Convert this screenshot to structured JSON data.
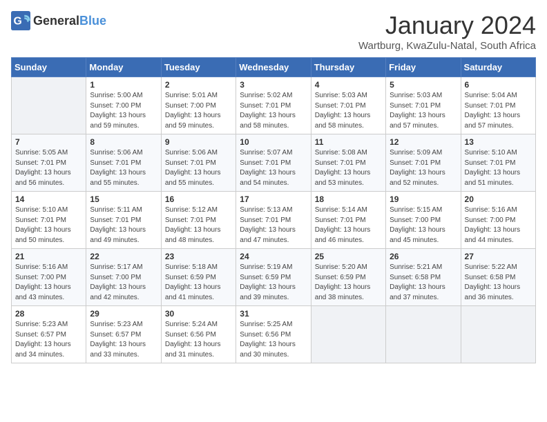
{
  "header": {
    "logo_general": "General",
    "logo_blue": "Blue",
    "month": "January 2024",
    "location": "Wartburg, KwaZulu-Natal, South Africa"
  },
  "weekdays": [
    "Sunday",
    "Monday",
    "Tuesday",
    "Wednesday",
    "Thursday",
    "Friday",
    "Saturday"
  ],
  "weeks": [
    [
      {
        "day": "",
        "sunrise": "",
        "sunset": "",
        "daylight": ""
      },
      {
        "day": "1",
        "sunrise": "Sunrise: 5:00 AM",
        "sunset": "Sunset: 7:00 PM",
        "daylight": "Daylight: 13 hours and 59 minutes."
      },
      {
        "day": "2",
        "sunrise": "Sunrise: 5:01 AM",
        "sunset": "Sunset: 7:00 PM",
        "daylight": "Daylight: 13 hours and 59 minutes."
      },
      {
        "day": "3",
        "sunrise": "Sunrise: 5:02 AM",
        "sunset": "Sunset: 7:01 PM",
        "daylight": "Daylight: 13 hours and 58 minutes."
      },
      {
        "day": "4",
        "sunrise": "Sunrise: 5:03 AM",
        "sunset": "Sunset: 7:01 PM",
        "daylight": "Daylight: 13 hours and 58 minutes."
      },
      {
        "day": "5",
        "sunrise": "Sunrise: 5:03 AM",
        "sunset": "Sunset: 7:01 PM",
        "daylight": "Daylight: 13 hours and 57 minutes."
      },
      {
        "day": "6",
        "sunrise": "Sunrise: 5:04 AM",
        "sunset": "Sunset: 7:01 PM",
        "daylight": "Daylight: 13 hours and 57 minutes."
      }
    ],
    [
      {
        "day": "7",
        "sunrise": "Sunrise: 5:05 AM",
        "sunset": "Sunset: 7:01 PM",
        "daylight": "Daylight: 13 hours and 56 minutes."
      },
      {
        "day": "8",
        "sunrise": "Sunrise: 5:06 AM",
        "sunset": "Sunset: 7:01 PM",
        "daylight": "Daylight: 13 hours and 55 minutes."
      },
      {
        "day": "9",
        "sunrise": "Sunrise: 5:06 AM",
        "sunset": "Sunset: 7:01 PM",
        "daylight": "Daylight: 13 hours and 55 minutes."
      },
      {
        "day": "10",
        "sunrise": "Sunrise: 5:07 AM",
        "sunset": "Sunset: 7:01 PM",
        "daylight": "Daylight: 13 hours and 54 minutes."
      },
      {
        "day": "11",
        "sunrise": "Sunrise: 5:08 AM",
        "sunset": "Sunset: 7:01 PM",
        "daylight": "Daylight: 13 hours and 53 minutes."
      },
      {
        "day": "12",
        "sunrise": "Sunrise: 5:09 AM",
        "sunset": "Sunset: 7:01 PM",
        "daylight": "Daylight: 13 hours and 52 minutes."
      },
      {
        "day": "13",
        "sunrise": "Sunrise: 5:10 AM",
        "sunset": "Sunset: 7:01 PM",
        "daylight": "Daylight: 13 hours and 51 minutes."
      }
    ],
    [
      {
        "day": "14",
        "sunrise": "Sunrise: 5:10 AM",
        "sunset": "Sunset: 7:01 PM",
        "daylight": "Daylight: 13 hours and 50 minutes."
      },
      {
        "day": "15",
        "sunrise": "Sunrise: 5:11 AM",
        "sunset": "Sunset: 7:01 PM",
        "daylight": "Daylight: 13 hours and 49 minutes."
      },
      {
        "day": "16",
        "sunrise": "Sunrise: 5:12 AM",
        "sunset": "Sunset: 7:01 PM",
        "daylight": "Daylight: 13 hours and 48 minutes."
      },
      {
        "day": "17",
        "sunrise": "Sunrise: 5:13 AM",
        "sunset": "Sunset: 7:01 PM",
        "daylight": "Daylight: 13 hours and 47 minutes."
      },
      {
        "day": "18",
        "sunrise": "Sunrise: 5:14 AM",
        "sunset": "Sunset: 7:01 PM",
        "daylight": "Daylight: 13 hours and 46 minutes."
      },
      {
        "day": "19",
        "sunrise": "Sunrise: 5:15 AM",
        "sunset": "Sunset: 7:00 PM",
        "daylight": "Daylight: 13 hours and 45 minutes."
      },
      {
        "day": "20",
        "sunrise": "Sunrise: 5:16 AM",
        "sunset": "Sunset: 7:00 PM",
        "daylight": "Daylight: 13 hours and 44 minutes."
      }
    ],
    [
      {
        "day": "21",
        "sunrise": "Sunrise: 5:16 AM",
        "sunset": "Sunset: 7:00 PM",
        "daylight": "Daylight: 13 hours and 43 minutes."
      },
      {
        "day": "22",
        "sunrise": "Sunrise: 5:17 AM",
        "sunset": "Sunset: 7:00 PM",
        "daylight": "Daylight: 13 hours and 42 minutes."
      },
      {
        "day": "23",
        "sunrise": "Sunrise: 5:18 AM",
        "sunset": "Sunset: 6:59 PM",
        "daylight": "Daylight: 13 hours and 41 minutes."
      },
      {
        "day": "24",
        "sunrise": "Sunrise: 5:19 AM",
        "sunset": "Sunset: 6:59 PM",
        "daylight": "Daylight: 13 hours and 39 minutes."
      },
      {
        "day": "25",
        "sunrise": "Sunrise: 5:20 AM",
        "sunset": "Sunset: 6:59 PM",
        "daylight": "Daylight: 13 hours and 38 minutes."
      },
      {
        "day": "26",
        "sunrise": "Sunrise: 5:21 AM",
        "sunset": "Sunset: 6:58 PM",
        "daylight": "Daylight: 13 hours and 37 minutes."
      },
      {
        "day": "27",
        "sunrise": "Sunrise: 5:22 AM",
        "sunset": "Sunset: 6:58 PM",
        "daylight": "Daylight: 13 hours and 36 minutes."
      }
    ],
    [
      {
        "day": "28",
        "sunrise": "Sunrise: 5:23 AM",
        "sunset": "Sunset: 6:57 PM",
        "daylight": "Daylight: 13 hours and 34 minutes."
      },
      {
        "day": "29",
        "sunrise": "Sunrise: 5:23 AM",
        "sunset": "Sunset: 6:57 PM",
        "daylight": "Daylight: 13 hours and 33 minutes."
      },
      {
        "day": "30",
        "sunrise": "Sunrise: 5:24 AM",
        "sunset": "Sunset: 6:56 PM",
        "daylight": "Daylight: 13 hours and 31 minutes."
      },
      {
        "day": "31",
        "sunrise": "Sunrise: 5:25 AM",
        "sunset": "Sunset: 6:56 PM",
        "daylight": "Daylight: 13 hours and 30 minutes."
      },
      {
        "day": "",
        "sunrise": "",
        "sunset": "",
        "daylight": ""
      },
      {
        "day": "",
        "sunrise": "",
        "sunset": "",
        "daylight": ""
      },
      {
        "day": "",
        "sunrise": "",
        "sunset": "",
        "daylight": ""
      }
    ]
  ]
}
